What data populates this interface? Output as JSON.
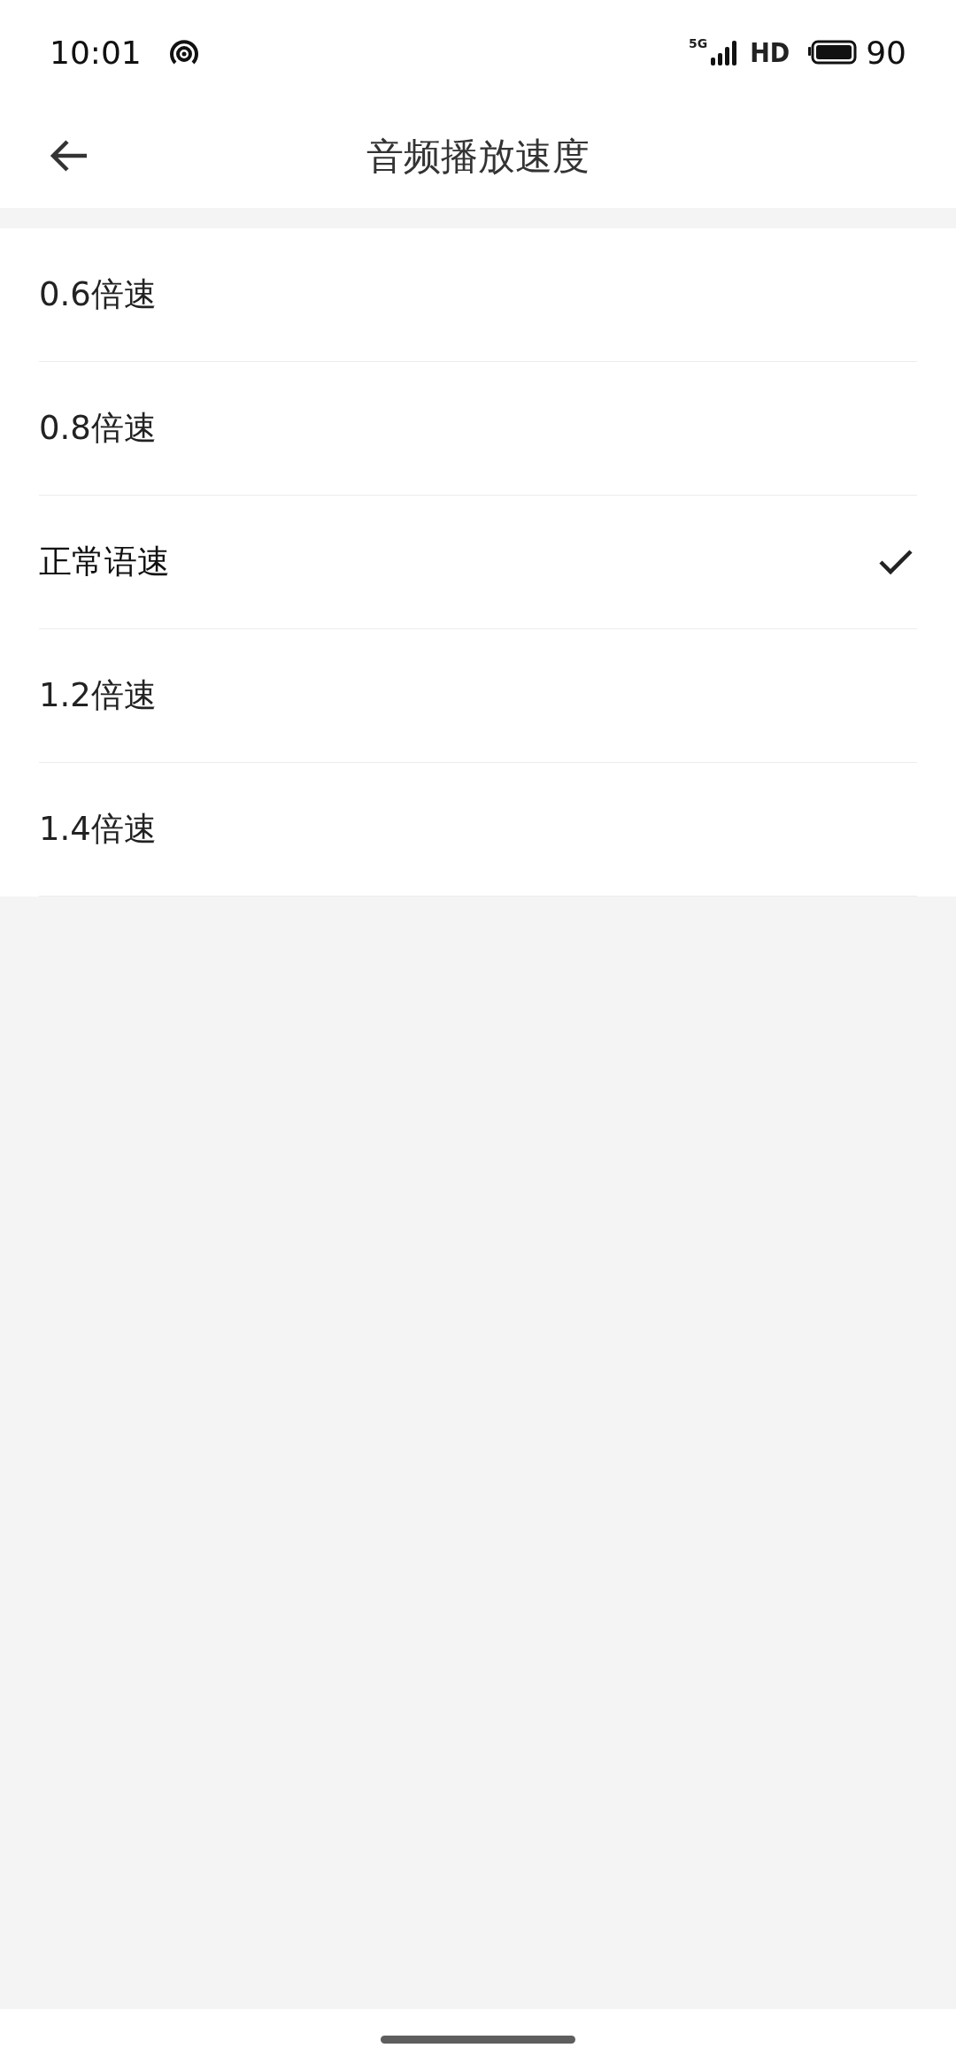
{
  "status_bar": {
    "time": "10:01",
    "network": "5G",
    "hd": "HD",
    "battery": "90"
  },
  "header": {
    "title": "音频播放速度"
  },
  "options": [
    {
      "label": "0.6倍速",
      "selected": false
    },
    {
      "label": "0.8倍速",
      "selected": false
    },
    {
      "label": "正常语速",
      "selected": true
    },
    {
      "label": "1.2倍速",
      "selected": false
    },
    {
      "label": "1.4倍速",
      "selected": false
    }
  ]
}
